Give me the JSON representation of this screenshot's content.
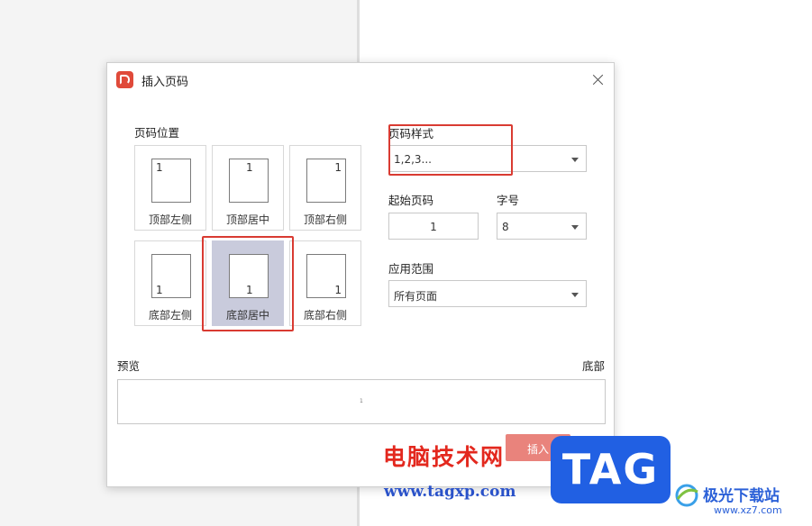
{
  "dialog": {
    "title": "插入页码",
    "position_label": "页码位置",
    "style_label": "页码样式",
    "style_value": "1,2,3...",
    "start_label": "起始页码",
    "start_value": "1",
    "fontsize_label": "字号",
    "fontsize_value": "8",
    "scope_label": "应用范围",
    "scope_value": "所有页面",
    "preview_label": "预览",
    "preview_position": "底部",
    "preview_number": "1",
    "insert_button": "插入",
    "positions": [
      {
        "label": "顶部左侧",
        "num": "1"
      },
      {
        "label": "顶部居中",
        "num": "1"
      },
      {
        "label": "顶部右侧",
        "num": "1"
      },
      {
        "label": "底部左侧",
        "num": "1"
      },
      {
        "label": "底部居中",
        "num": "1",
        "selected": true
      },
      {
        "label": "底部右侧",
        "num": "1"
      }
    ]
  },
  "watermark": {
    "text": "电脑技术网",
    "url": "www.tagxp.com",
    "tag": "TAG",
    "site": "极光下载站",
    "domain": "www.xz7.com"
  }
}
